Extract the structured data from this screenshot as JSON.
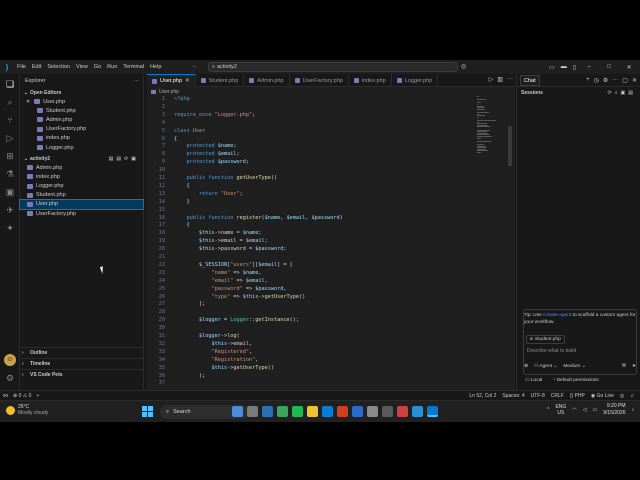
{
  "titlebar": {
    "menu": [
      "File",
      "Edit",
      "Selection",
      "View",
      "Go",
      "Run",
      "Terminal",
      "Help"
    ],
    "search_value": "activity2"
  },
  "sidebar": {
    "title": "Explorer",
    "open_editors_label": "Open Editors",
    "open_editors": [
      "User.php",
      "Student.php",
      "Admin.php",
      "UserFactory.php",
      "index.php",
      "Logger.php"
    ],
    "folder_label": "activity2",
    "files": [
      "Admin.php",
      "index.php",
      "Logger.php",
      "Student.php",
      "User.php",
      "UserFactory.php"
    ],
    "selected_file": "User.php",
    "outline_label": "Outline",
    "timeline_label": "Timeline",
    "vscode_pets_label": "VS Code Pets"
  },
  "editor": {
    "tabs": [
      {
        "label": "User.php",
        "active": true
      },
      {
        "label": "Student.php",
        "active": false
      },
      {
        "label": "Admin.php",
        "active": false
      },
      {
        "label": "UserFactory.php",
        "active": false
      },
      {
        "label": "index.php",
        "active": false
      },
      {
        "label": "Logger.php",
        "active": false
      }
    ],
    "breadcrumb": "User.php",
    "lines": [
      {
        "n": "1",
        "t": "<?php"
      },
      {
        "n": "2",
        "t": ""
      },
      {
        "n": "3",
        "t": "require_once \"Logger.php\";"
      },
      {
        "n": "4",
        "t": ""
      },
      {
        "n": "5",
        "t": "class User"
      },
      {
        "n": "6",
        "t": "{"
      },
      {
        "n": "7",
        "t": "    protected $name;"
      },
      {
        "n": "8",
        "t": "    protected $email;"
      },
      {
        "n": "9",
        "t": "    protected $password;"
      },
      {
        "n": "10",
        "t": ""
      },
      {
        "n": "11",
        "t": "    public function getUserType()"
      },
      {
        "n": "12",
        "t": "    {"
      },
      {
        "n": "13",
        "t": "        return \"User\";"
      },
      {
        "n": "14",
        "t": "    }"
      },
      {
        "n": "15",
        "t": ""
      },
      {
        "n": "16",
        "t": "    public function register($name, $email, $password)"
      },
      {
        "n": "17",
        "t": "    {"
      },
      {
        "n": "18",
        "t": "        $this->name = $name;"
      },
      {
        "n": "19",
        "t": "        $this->email = $email;"
      },
      {
        "n": "20",
        "t": "        $this->password = $password;"
      },
      {
        "n": "21",
        "t": ""
      },
      {
        "n": "22",
        "t": "        $_SESSION[\"users\"][$email] = ["
      },
      {
        "n": "23",
        "t": "            \"name\" => $name,"
      },
      {
        "n": "24",
        "t": "            \"email\" => $email,"
      },
      {
        "n": "25",
        "t": "            \"password\" => $password,"
      },
      {
        "n": "26",
        "t": "            \"type\" => $this->getUserType()"
      },
      {
        "n": "27",
        "t": "        ];"
      },
      {
        "n": "28",
        "t": ""
      },
      {
        "n": "29",
        "t": "        $logger = Logger::getInstance();"
      },
      {
        "n": "30",
        "t": ""
      },
      {
        "n": "31",
        "t": "        $logger->log("
      },
      {
        "n": "32",
        "t": "            $this->email,"
      },
      {
        "n": "33",
        "t": "            \"Registered\","
      },
      {
        "n": "34",
        "t": "            \"Registration\","
      },
      {
        "n": "35",
        "t": "            $this->getUserType()"
      },
      {
        "n": "36",
        "t": "        );"
      },
      {
        "n": "37",
        "t": ""
      }
    ]
  },
  "chat": {
    "tab_label": "Chat",
    "sessions_label": "Sessions",
    "tip_prefix": "Tip: Use ",
    "tip_link": "/create-agent",
    "tip_suffix": " to scaffold a custom agent for your workflow.",
    "file_chip": "Student.php",
    "input_placeholder": "Describe what to build",
    "agent_label": "Agent",
    "model_label": "Medium",
    "local_label": "Local",
    "permissions_label": "Default permissions"
  },
  "statusbar": {
    "errors": "0",
    "warnings": "0",
    "position": "Ln 52, Col 2",
    "spaces": "Spaces: 4",
    "encoding": "UTF-8",
    "eol": "CRLF",
    "language": "PHP",
    "golive": "Go Live"
  },
  "taskbar": {
    "temp": "25°C",
    "weather": "Mostly cloudy",
    "search_label": "Search",
    "lang": "ENG",
    "region": "US",
    "time": "9:20 PM",
    "date": "9/15/2026"
  },
  "colors": {
    "accent": "#0078d4",
    "bg": "#1f1f1f",
    "sidebar": "#181818"
  }
}
